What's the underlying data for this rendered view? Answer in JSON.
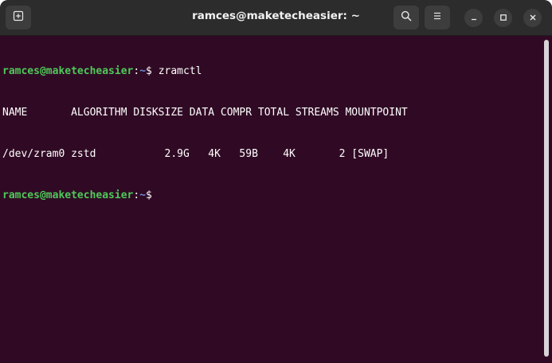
{
  "window": {
    "title": "ramces@maketecheasier: ~"
  },
  "titlebar": {
    "new_tab_icon": "new-tab-icon",
    "search_icon": "search-icon",
    "menu_icon": "hamburger-menu-icon",
    "minimize_icon": "minimize-icon",
    "maximize_icon": "maximize-icon",
    "close_icon": "close-icon"
  },
  "colors": {
    "background": "#300a24",
    "titlebar": "#2c2c2c",
    "prompt_user": "#4ec959",
    "prompt_path": "#6c8cdb",
    "text": "#ffffff"
  },
  "terminal": {
    "prompt1": {
      "user_host": "ramces@maketecheasier",
      "sep": ":",
      "path": "~",
      "symbol": "$ ",
      "command": "zramctl"
    },
    "output_header": "NAME       ALGORITHM DISKSIZE DATA COMPR TOTAL STREAMS MOUNTPOINT",
    "output_row": "/dev/zram0 zstd           2.9G   4K   59B    4K       2 [SWAP]",
    "prompt2": {
      "user_host": "ramces@maketecheasier",
      "sep": ":",
      "path": "~",
      "symbol": "$ ",
      "command": ""
    }
  }
}
